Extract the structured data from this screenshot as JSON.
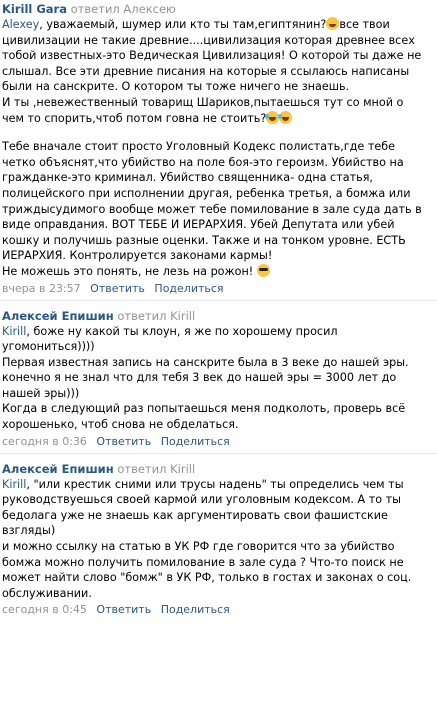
{
  "comments": [
    {
      "author": "Kirill Gara",
      "replied_to": "ответил Алексею",
      "mention": "Alexey",
      "line1_rest": ", уважаемый, шумер или кто ты там,египтянин?",
      "line1_after": "все твои",
      "lines": [
        "цивилизации не такие древние....цивилизация которая древнее всех",
        "тобой известных-это Ведическая Цивилизация! О которой ты даже не",
        "слышал. Все эти древние писания на которые я ссылаюсь написаны",
        "были на санскрите. О котором ты тоже ничего не знаешь.",
        "И ты ,невежественный товарищ Шариков,пытаешься тут со мной о"
      ],
      "line_emoji": "чем то спорить,чтоб потом говна не стоить?",
      "lines2": [
        "Тебе вначале стоит просто Уголовный Кодекс полистать,где тебе",
        "четко объяснят,что убийство на поле боя-это героизм. Убийство на",
        "гражданке-это криминал. Убийство священника- одна статья,",
        "полицейского при исполнении другая, ребенка третья, а бомжа или",
        "триждысудимого вообще может тебе помилование в зале суда дать в",
        "виде оправдания. ВОТ ТЕБЕ И ИЕРАРХИЯ. Убей Депутата или убей",
        "кошку и получишь разные оценки. Также и на тонком уровне. ЕСТЬ",
        "ИЕРАРХИЯ. Контролируется законами кармы!"
      ],
      "last_line": "Не можешь это понять, не лезь на рожон!",
      "time": "вчера в 23:57",
      "reply": "Ответить",
      "share": "Поделиться"
    },
    {
      "author": "Алексей Епишин",
      "replied_to": "ответил Kirill",
      "mention": "Kirill",
      "first_rest": ", боже ну какой ты клоун, я же по хорошему просил",
      "lines": [
        "угомониться))))",
        "Первая известная запись на санскрите была в 3 веке до нашей эры.",
        "конечно я не знал что для тебя 3 век до нашей эры = 3000 лет до",
        "нашей эры)))",
        "Когда в следующий раз попытаешься меня подколоть, проверь всё",
        "хорошенько, чтоб снова не обделаться."
      ],
      "time": "сегодня в 0:36",
      "reply": "Ответить",
      "share": "Поделиться"
    },
    {
      "author": "Алексей Епишин",
      "replied_to": "ответил Kirill",
      "mention": "Kirill",
      "first_rest": ", \"или крестик сними или трусы надень\" ты определись чем ты",
      "lines": [
        "руководствуешься своей кармой или уголовным кодексом. А то ты",
        "бедолага уже не знаешь как аргументировать свои фашистские",
        "взгляды)",
        "и можно ссылку на статью в УК РФ где говорится что за убийство",
        "бомжа можно получить помилование в зале суда ? Что-то поиск не",
        "может найти слово \"бомж\" в УК РФ, только в гостах и законах о соц.",
        "обслуживании."
      ],
      "time": "сегодня в 0:45",
      "reply": "Ответить",
      "share": "Поделиться"
    }
  ]
}
